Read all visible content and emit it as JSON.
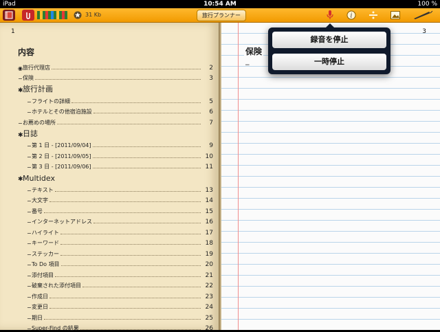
{
  "status_bar": {
    "device": "iPad",
    "time": "10:54 AM",
    "battery": "100 %"
  },
  "toolbar": {
    "size": "31 Kb",
    "document_title": "旅行プランナー"
  },
  "left_page": {
    "page_number": "1",
    "toc_title": "内容",
    "items": [
      {
        "bullet": "◉",
        "label": "旅行代理店",
        "page": "2",
        "kind": "item",
        "indent": 1
      },
      {
        "bullet": "−",
        "label": "保険",
        "page": "3",
        "kind": "item",
        "indent": 1
      },
      {
        "bullet": "✱",
        "label": "旅行計画",
        "page": "",
        "kind": "section",
        "indent": 1
      },
      {
        "bullet": "−",
        "label": "フライトの詳細",
        "page": "5",
        "kind": "item",
        "indent": 2
      },
      {
        "bullet": "−",
        "label": "ホテルとその他宿泊施設",
        "page": "6",
        "kind": "item",
        "indent": 2
      },
      {
        "bullet": "−",
        "label": "お薦めの場所",
        "page": "7",
        "kind": "item",
        "indent": 1
      },
      {
        "bullet": "✱",
        "label": "日誌",
        "page": "",
        "kind": "section",
        "indent": 1
      },
      {
        "bullet": "−",
        "label": "第 1 日 - [2011/09/04]",
        "page": "9",
        "kind": "item",
        "indent": 2
      },
      {
        "bullet": "−",
        "label": "第 2 日 - [2011/09/05]",
        "page": "10",
        "kind": "item",
        "indent": 2
      },
      {
        "bullet": "−",
        "label": "第 3 日 - [2011/09/06]",
        "page": "11",
        "kind": "item",
        "indent": 2
      },
      {
        "bullet": "✱",
        "label": "Multidex",
        "page": "",
        "kind": "section",
        "indent": 1
      },
      {
        "bullet": "−",
        "label": "テキスト",
        "page": "13",
        "kind": "item",
        "indent": 2
      },
      {
        "bullet": "−",
        "label": "大文字",
        "page": "14",
        "kind": "item",
        "indent": 2
      },
      {
        "bullet": "−",
        "label": "番号",
        "page": "15",
        "kind": "item",
        "indent": 2
      },
      {
        "bullet": "−",
        "label": "インターネットアドレス",
        "page": "16",
        "kind": "item",
        "indent": 2
      },
      {
        "bullet": "−",
        "label": "ハイライト",
        "page": "17",
        "kind": "item",
        "indent": 2
      },
      {
        "bullet": "−",
        "label": "キーワード",
        "page": "18",
        "kind": "item",
        "indent": 2
      },
      {
        "bullet": "−",
        "label": "ステッカー",
        "page": "19",
        "kind": "item",
        "indent": 2
      },
      {
        "bullet": "−",
        "label": "To Do 項目",
        "page": "20",
        "kind": "item",
        "indent": 2
      },
      {
        "bullet": "−",
        "label": "添付項目",
        "page": "21",
        "kind": "item",
        "indent": 2
      },
      {
        "bullet": "−",
        "label": "破棄された添付項目",
        "page": "22",
        "kind": "item",
        "indent": 2
      },
      {
        "bullet": "−",
        "label": "作成日",
        "page": "23",
        "kind": "item",
        "indent": 2
      },
      {
        "bullet": "−",
        "label": "変更日",
        "page": "24",
        "kind": "item",
        "indent": 2
      },
      {
        "bullet": "−",
        "label": "期日",
        "page": "25",
        "kind": "item",
        "indent": 2
      },
      {
        "bullet": "−",
        "label": "Super-Find の結果",
        "page": "26",
        "kind": "item",
        "indent": 2
      }
    ]
  },
  "right_page": {
    "page_number": "3",
    "heading": "保険",
    "bullet": "−"
  },
  "popover": {
    "stop_label": "録音を停止",
    "pause_label": "一時停止"
  },
  "colors": {
    "toolbar": "#f5a400",
    "page_left": "#f3e6c4",
    "rule_line": "#b9d4ea",
    "margin_line": "#f08d8d",
    "popover": "#101a2c"
  }
}
